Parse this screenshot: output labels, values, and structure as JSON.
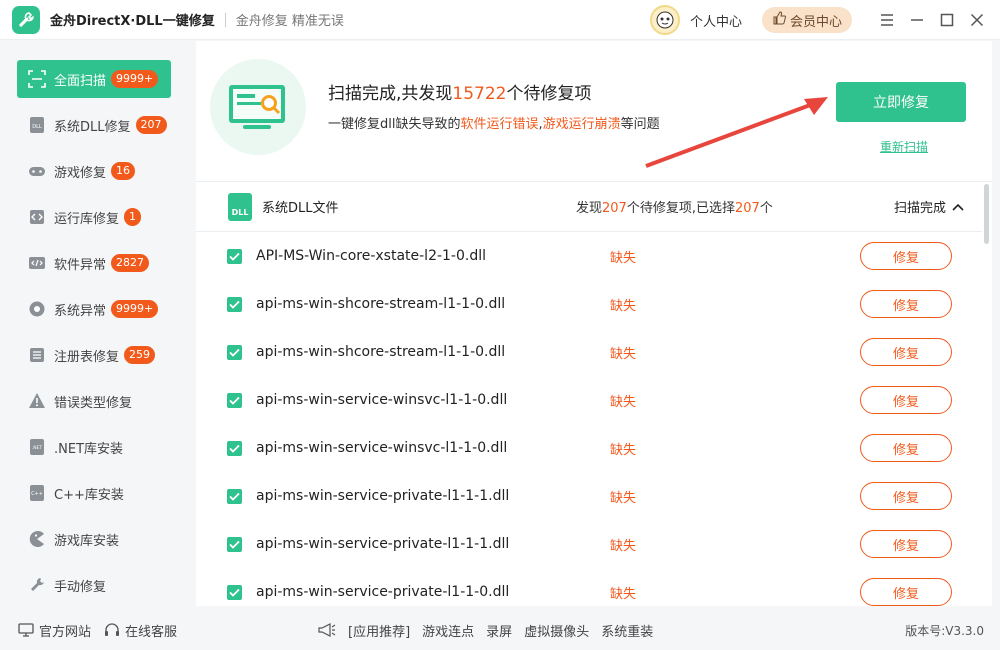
{
  "titlebar": {
    "app_title": "金舟DirectX·DLL一键修复",
    "slogan": "金舟修复 精准无误",
    "personal": "个人中心",
    "vip": "会员中心"
  },
  "sidebar": {
    "items": [
      {
        "label": "全面扫描",
        "badge": "9999+"
      },
      {
        "label": "系统DLL修复",
        "badge": "207"
      },
      {
        "label": "游戏修复",
        "badge": "16"
      },
      {
        "label": "运行库修复",
        "badge": "1"
      },
      {
        "label": "软件异常",
        "badge": "2827"
      },
      {
        "label": "系统异常",
        "badge": "9999+"
      },
      {
        "label": "注册表修复",
        "badge": "259"
      },
      {
        "label": "错误类型修复",
        "badge": ""
      },
      {
        "label": ".NET库安装",
        "badge": ""
      },
      {
        "label": "C++库安装",
        "badge": ""
      },
      {
        "label": "游戏库安装",
        "badge": ""
      },
      {
        "label": "手动修复",
        "badge": ""
      }
    ]
  },
  "header": {
    "title_pre": "扫描完成,共发现",
    "title_num": "15722",
    "title_post": "个待修复项",
    "sub_pre": "一键修复dll缺失导致的",
    "sub_hl1": "软件运行错误",
    "sub_comma": ",",
    "sub_hl2": "游戏运行崩溃",
    "sub_post": "等问题",
    "fix_all": "立即修复",
    "rescan": "重新扫描"
  },
  "group": {
    "icon_text": "DLL",
    "title": "系统DLL文件",
    "sum_pre": "发现",
    "sum_num1": "207",
    "sum_mid": "个待修复项,已选择",
    "sum_num2": "207",
    "sum_post": "个",
    "status": "扫描完成"
  },
  "rows": [
    {
      "file": "API-MS-Win-core-xstate-l2-1-0.dll",
      "status": "缺失",
      "action": "修复"
    },
    {
      "file": "api-ms-win-shcore-stream-l1-1-0.dll",
      "status": "缺失",
      "action": "修复"
    },
    {
      "file": "api-ms-win-shcore-stream-l1-1-0.dll",
      "status": "缺失",
      "action": "修复"
    },
    {
      "file": "api-ms-win-service-winsvc-l1-1-0.dll",
      "status": "缺失",
      "action": "修复"
    },
    {
      "file": "api-ms-win-service-winsvc-l1-1-0.dll",
      "status": "缺失",
      "action": "修复"
    },
    {
      "file": "api-ms-win-service-private-l1-1-1.dll",
      "status": "缺失",
      "action": "修复"
    },
    {
      "file": "api-ms-win-service-private-l1-1-1.dll",
      "status": "缺失",
      "action": "修复"
    },
    {
      "file": "api-ms-win-service-private-l1-1-0.dll",
      "status": "缺失",
      "action": "修复"
    }
  ],
  "footer": {
    "website": "官方网站",
    "service": "在线客服",
    "recommend": "[应用推荐]",
    "links": [
      "游戏连点",
      "录屏",
      "虚拟摄像头",
      "系统重装"
    ],
    "version": "版本号:V3.3.0"
  },
  "colors": {
    "accent": "#2fc28e",
    "warning": "#f25a1c"
  }
}
